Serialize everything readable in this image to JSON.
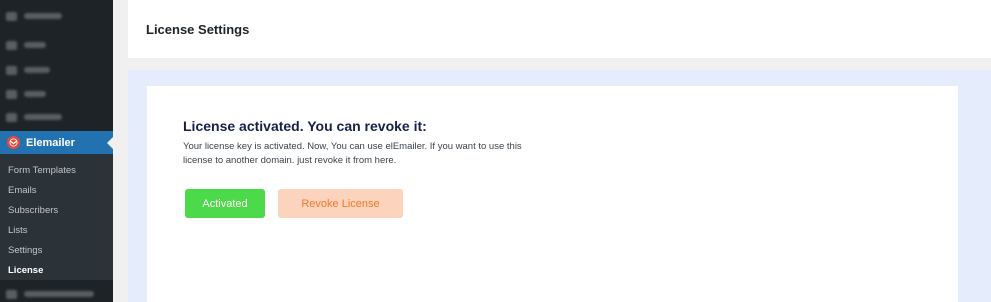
{
  "sidebar": {
    "active_menu": {
      "label": "Elemailer",
      "icon": "elemailer-logo-icon"
    },
    "submenu": [
      {
        "label": "Form Templates"
      },
      {
        "label": "Emails"
      },
      {
        "label": "Subscribers"
      },
      {
        "label": "Lists"
      },
      {
        "label": "Settings"
      },
      {
        "label": "License",
        "current": true
      }
    ]
  },
  "header": {
    "title": "License Settings"
  },
  "license": {
    "title": "License activated. You can revoke it:",
    "description": "Your license key is activated. Now, You can use elEmailer. If you want to use this license to another domain. just revoke it from here.",
    "activated_label": "Activated",
    "revoke_label": "Revoke License"
  },
  "colors": {
    "sidebar_bg": "#1d2327",
    "active_menu": "#2271b1",
    "activated_button": "#4cd94a",
    "revoke_button_bg": "#fcd4bd",
    "revoke_button_text": "#f07a2a",
    "panel_bg": "#e5edfd"
  }
}
